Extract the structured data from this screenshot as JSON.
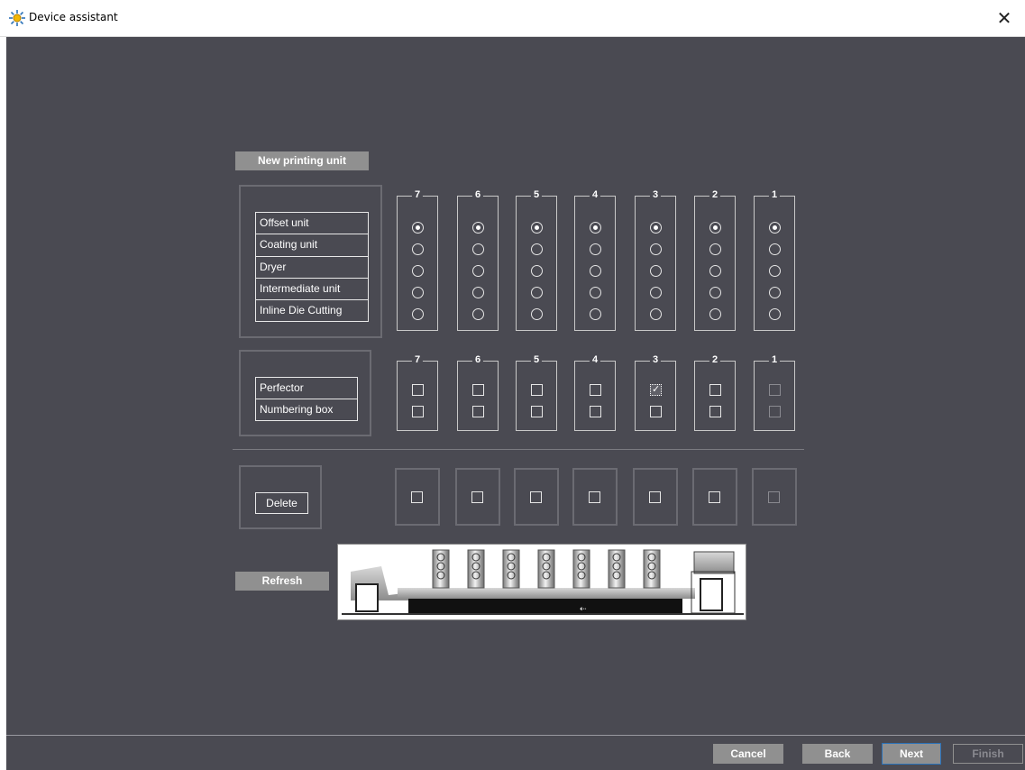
{
  "window": {
    "title": "Device assistant",
    "close_glyph": "✕"
  },
  "section_label": "New printing unit",
  "unit_numbers": [
    "7",
    "6",
    "5",
    "4",
    "3",
    "2",
    "1"
  ],
  "unit_types": [
    "Offset unit",
    "Coating unit",
    "Dryer",
    "Intermediate unit",
    "Inline Die Cutting"
  ],
  "unit_type_selected_row": 0,
  "options": [
    "Perfector",
    "Numbering box"
  ],
  "options_checked": {
    "column": "3",
    "option": "Perfector"
  },
  "delete_label": "Delete",
  "refresh_label": "Refresh",
  "footer": {
    "cancel": "Cancel",
    "back": "Back",
    "next": "Next",
    "finish": "Finish"
  },
  "colors": {
    "background": "#4a4a52",
    "button_gray": "#909090",
    "accent_blue": "#2b72b8"
  },
  "icons": {
    "app": "device-assistant-icon",
    "close": "close-icon"
  }
}
